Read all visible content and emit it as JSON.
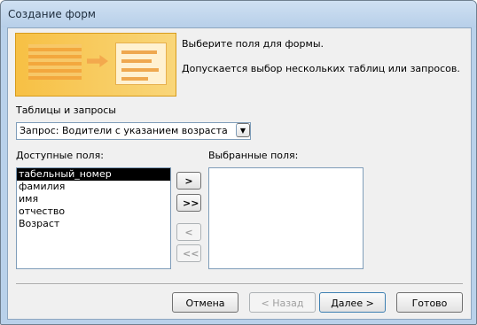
{
  "window": {
    "title": "Создание форм"
  },
  "info": {
    "line1": "Выберите поля для формы.",
    "line2": "Допускается выбор нескольких таблиц или запросов."
  },
  "tables": {
    "label": "Таблицы и запросы",
    "selected": "Запрос: Водители с указанием возраста",
    "dropdown_icon": "chevron-down-icon"
  },
  "available": {
    "label": "Доступные поля:",
    "items": [
      "табельный_номер",
      "фамилия",
      "имя",
      "отчество",
      "Возраст"
    ],
    "selected_index": 0
  },
  "chosen": {
    "label": "Выбранные поля:",
    "items": []
  },
  "move_buttons": {
    "add_one": ">",
    "add_all": ">>",
    "remove_one": "<",
    "remove_all": "<<"
  },
  "footer": {
    "cancel": "Отмена",
    "back": "< Назад",
    "next": "Далее >",
    "finish": "Готово"
  }
}
